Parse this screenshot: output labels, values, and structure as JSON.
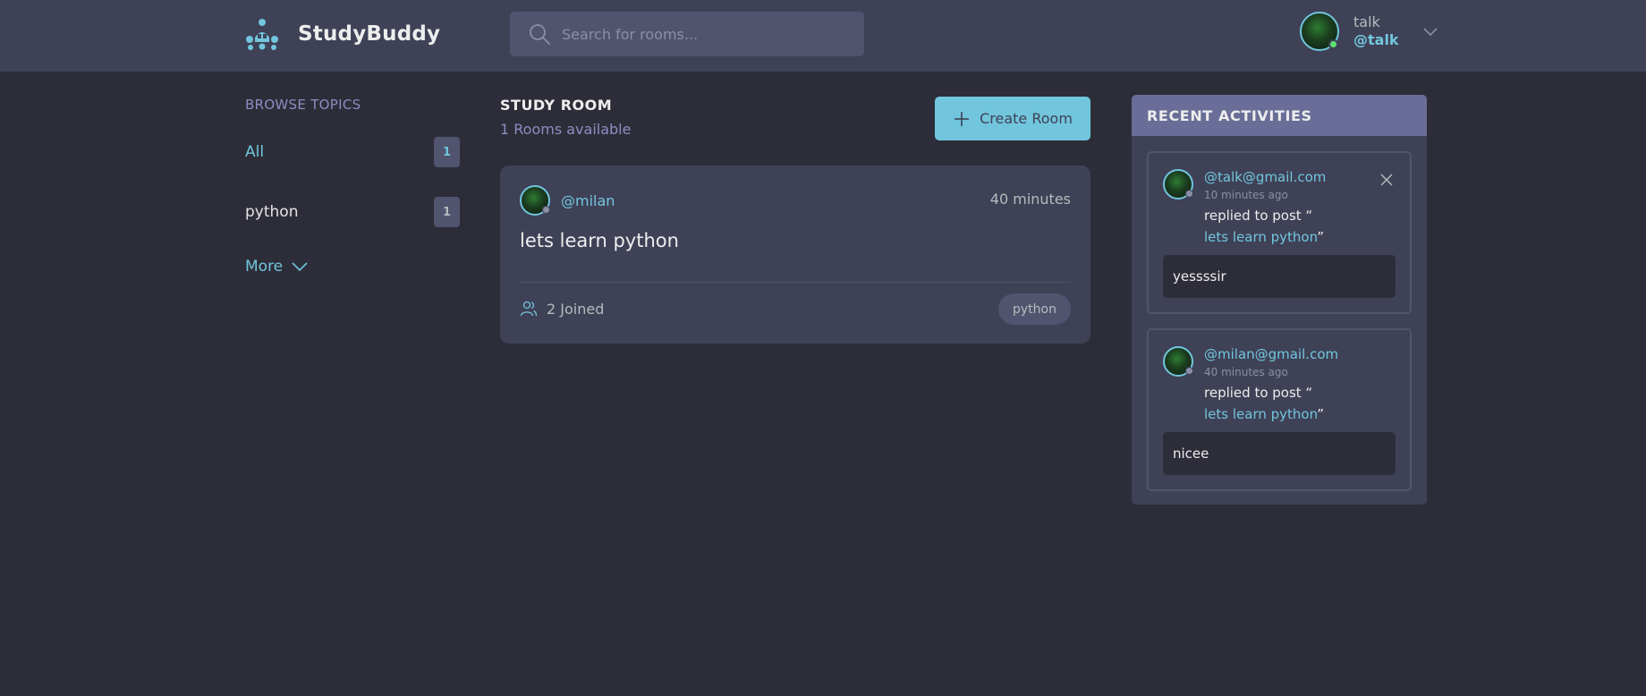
{
  "header": {
    "brand": "StudyBuddy",
    "search_placeholder": "Search for rooms...",
    "user_name": "talk",
    "user_handle": "@talk"
  },
  "topics": {
    "title": "BROWSE TOPICS",
    "items": [
      {
        "label": "All",
        "count": "1",
        "active": true
      },
      {
        "label": "python",
        "count": "1",
        "active": false
      }
    ],
    "more_label": "More"
  },
  "main": {
    "title": "STUDY ROOM",
    "subtitle": "1 Rooms available",
    "create_label": "Create Room",
    "rooms": [
      {
        "host": "@milan",
        "time": "40 minutes",
        "title": "lets learn python",
        "joined": "2 Joined",
        "topic": "python"
      }
    ]
  },
  "activities": {
    "title": "RECENT ACTIVITIES",
    "items": [
      {
        "email": "@talk@gmail.com",
        "ago": "10 minutes ago",
        "action": "replied to post “",
        "post": "lets learn python",
        "post_suffix": "”",
        "message": "yessssir",
        "deletable": true
      },
      {
        "email": "@milan@gmail.com",
        "ago": "40 minutes ago",
        "action": "replied to post “",
        "post": "lets learn python",
        "post_suffix": "”",
        "message": "nicee",
        "deletable": false
      }
    ]
  },
  "colors": {
    "background": "#2d2d39",
    "surface": "#3f4156",
    "accent": "#71c6dd",
    "activity_header": "#696d97"
  }
}
